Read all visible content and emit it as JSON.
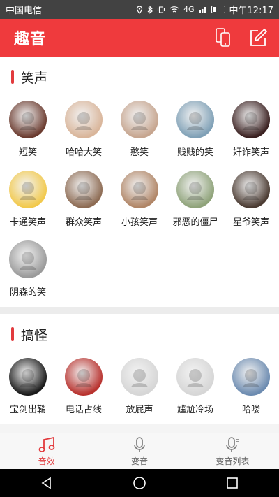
{
  "statusbar": {
    "carrier": "中国电信",
    "time": "中午12:17",
    "network": "4G",
    "battery_level": 0.3
  },
  "appbar": {
    "title": "趣音"
  },
  "sections": [
    {
      "title": "笑声",
      "items": [
        {
          "label": "短笑",
          "color": "#6b3b2f"
        },
        {
          "label": "哈哈大笑",
          "color": "#d9b59a"
        },
        {
          "label": "憨笑",
          "color": "#c6a58f"
        },
        {
          "label": "贱贱的笑",
          "color": "#7fa0b6"
        },
        {
          "label": "奸诈笑声",
          "color": "#3a2020"
        },
        {
          "label": "卡通笑声",
          "color": "#f2c94c"
        },
        {
          "label": "群众笑声",
          "color": "#8d6b53"
        },
        {
          "label": "小孩笑声",
          "color": "#b08566"
        },
        {
          "label": "邪恶的僵尸",
          "color": "#8fa37a"
        },
        {
          "label": "星爷笑声",
          "color": "#4b3b32"
        },
        {
          "label": "阴森的笑",
          "color": "#9a9a9a"
        }
      ]
    },
    {
      "title": "搞怪",
      "items": [
        {
          "label": "宝剑出鞘",
          "color": "#1a1a1a"
        },
        {
          "label": "电话占线",
          "color": "#b8322e"
        },
        {
          "label": "放屁声",
          "color": "#d6d6d6"
        },
        {
          "label": "尴尬冷场",
          "color": "#d6d6d6"
        },
        {
          "label": "哈喽",
          "color": "#6c8bb0"
        }
      ]
    }
  ],
  "tabs": [
    {
      "label": "音效",
      "icon": "music-note-icon",
      "active": true
    },
    {
      "label": "变音",
      "icon": "microphone-icon",
      "active": false
    },
    {
      "label": "变音列表",
      "icon": "mic-list-icon",
      "active": false
    }
  ],
  "colors": {
    "accent": "#ef3a3d",
    "statusbar": "#424242",
    "tab_active": "#e23b3e"
  }
}
